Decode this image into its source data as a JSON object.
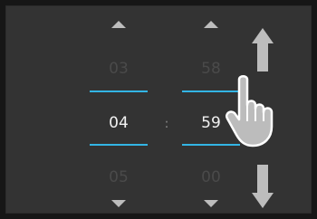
{
  "picker": {
    "hours": {
      "previous": "03",
      "current": "04",
      "next": "05"
    },
    "separator": ":",
    "minutes": {
      "previous": "58",
      "current": "59",
      "next": "00"
    }
  },
  "icons": {
    "hour_up": "chevron-up-icon",
    "hour_down": "chevron-down-icon",
    "minute_up": "chevron-up-icon",
    "minute_down": "chevron-down-icon",
    "scroll_up": "arrow-up-icon",
    "scroll_down": "arrow-down-icon",
    "gesture": "hand-pointer-icon"
  },
  "colors": {
    "background": "#333333",
    "accent": "#33b5e5",
    "current_text": "#f2f2f2",
    "faded_text": "#4a4a4a",
    "arrow": "#bdbdbd"
  }
}
